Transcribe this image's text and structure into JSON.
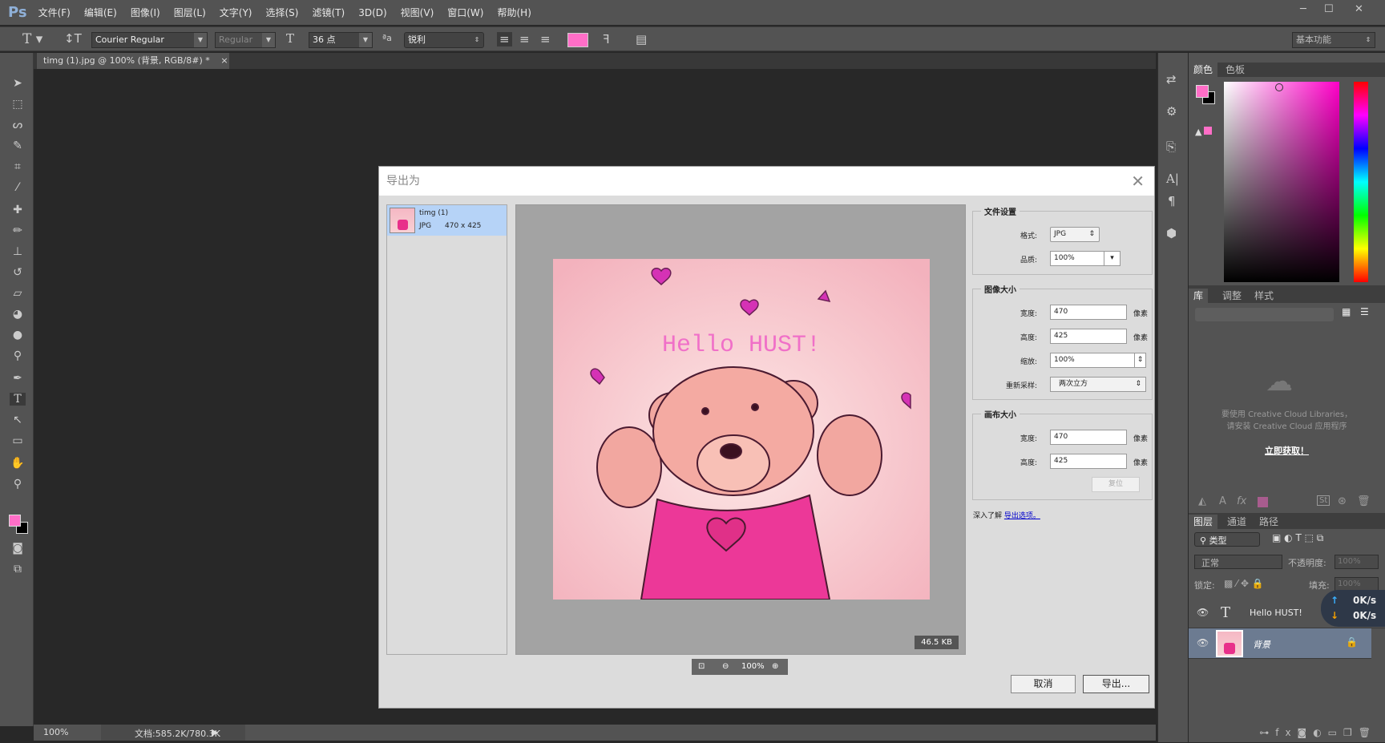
{
  "app": {
    "logo": "Ps",
    "menus": [
      "文件(F)",
      "编辑(E)",
      "图像(I)",
      "图层(L)",
      "文字(Y)",
      "选择(S)",
      "滤镜(T)",
      "3D(D)",
      "视图(V)",
      "窗口(W)",
      "帮助(H)"
    ],
    "window_buttons": [
      "─",
      "☐",
      "✕"
    ]
  },
  "options": {
    "font_family": "Courier Regular",
    "font_style": "Regular",
    "font_size": "36 点",
    "antialias": "锐利",
    "text_color": "#ff6ec7",
    "workspace": "基本功能"
  },
  "document_tab": {
    "title": "timg (1).jpg @ 100% (背景, RGB/8#) *",
    "close": "×"
  },
  "status": {
    "zoom": "100%",
    "doc": "文档:585.2K/780.3K"
  },
  "dialog": {
    "title": "导出为",
    "close": "✕",
    "file": {
      "name": "timg (1)",
      "format": "JPG",
      "dims": "470 x 425"
    },
    "preview": {
      "text": "Hello HUST!",
      "file_size": "46.5 KB",
      "zoom": "100%"
    },
    "file_settings": {
      "title": "文件设置",
      "format_label": "格式:",
      "format": "JPG",
      "quality_label": "品质:",
      "quality": "100%"
    },
    "image_size": {
      "title": "图像大小",
      "width_label": "宽度:",
      "width": "470",
      "height_label": "高度:",
      "height": "425",
      "unit": "像素",
      "scale_label": "缩放:",
      "scale": "100%",
      "resample_label": "重新采样:",
      "resample": "两次立方"
    },
    "canvas_size": {
      "title": "画布大小",
      "width_label": "宽度:",
      "width": "470",
      "height_label": "高度:",
      "height": "425",
      "unit": "像素",
      "reset": "复位"
    },
    "learn_more": "深入了解",
    "learn_link": "导出选项。",
    "cancel": "取消",
    "export": "导出..."
  },
  "panels": {
    "color_tabs": [
      "颜色",
      "色板"
    ],
    "library_tabs": [
      "库",
      "调整",
      "样式"
    ],
    "library_msg1": "要使用 Creative Cloud Libraries，",
    "library_msg2": "请安装 Creative Cloud 应用程序",
    "library_link": "立即获取！",
    "layer_tabs": [
      "图层",
      "通道",
      "路径"
    ],
    "filter": "类型",
    "blend": "正常",
    "opacity_label": "不透明度:",
    "opacity": "100%",
    "lock_label": "锁定:",
    "fill_label": "填充:",
    "fill": "100%",
    "layers": [
      {
        "name": "Hello HUST!",
        "type": "text"
      },
      {
        "name": "背景",
        "type": "image",
        "selected": true
      }
    ],
    "net": {
      "up": "0K/s",
      "down": "0K/s"
    }
  }
}
